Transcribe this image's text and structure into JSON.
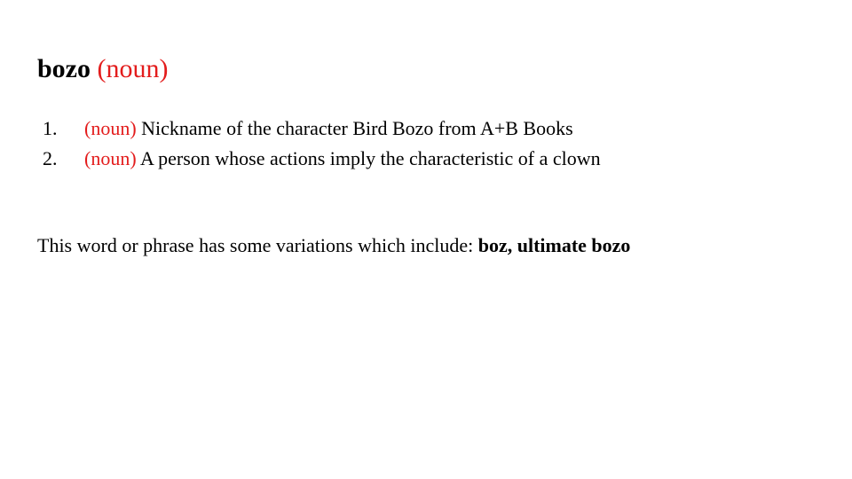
{
  "entry": {
    "word": "bozo",
    "pos": "(noun)"
  },
  "definitions": [
    {
      "number": "1.",
      "pos": "(noun)",
      "text": "Nickname of the character Bird Bozo from A+B Books"
    },
    {
      "number": "2.",
      "pos": "(noun)",
      "text": "A person whose actions imply the characteristic of a clown"
    }
  ],
  "variations": {
    "intro": "This word or phrase has some variations which include:",
    "list": "boz, ultimate bozo"
  },
  "colors": {
    "accent": "#e31c1c",
    "text": "#000000",
    "background": "#ffffff"
  }
}
